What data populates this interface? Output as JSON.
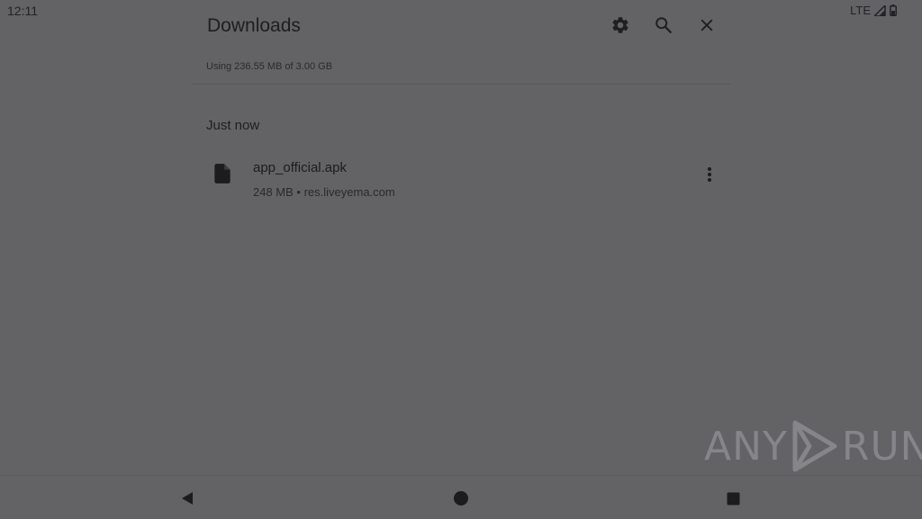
{
  "status_bar": {
    "time": "12:11",
    "network": "LTE"
  },
  "header": {
    "title": "Downloads",
    "settings_icon": "gear-icon",
    "search_icon": "search-icon",
    "close_icon": "close-icon"
  },
  "storage": {
    "text": "Using 236.55 MB of 3.00 GB"
  },
  "section": {
    "label": "Just now"
  },
  "downloads": [
    {
      "name": "app_official.apk",
      "meta": "248 MB • res.liveyema.com",
      "icon": "file-icon"
    }
  ],
  "watermark": {
    "left": "ANY",
    "right": "RUN"
  },
  "nav_bar": {
    "back": "back-icon",
    "home": "home-icon",
    "recents": "recents-icon"
  }
}
